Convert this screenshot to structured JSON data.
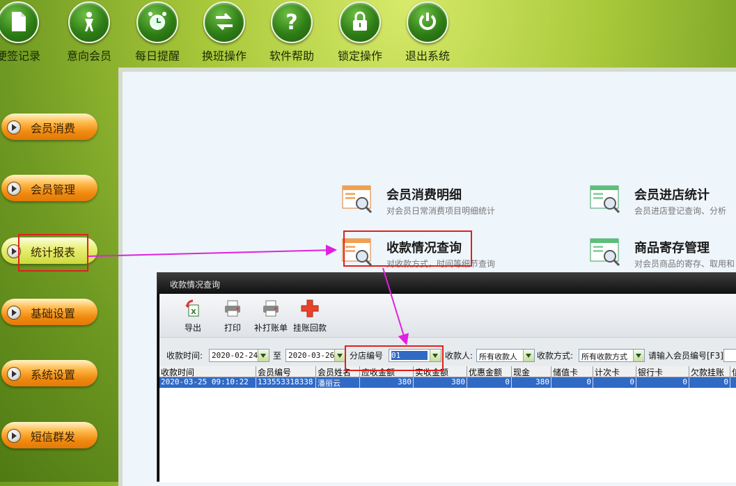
{
  "toolbar": {
    "items": [
      {
        "label": "便签记录",
        "icon": "note-icon"
      },
      {
        "label": "意向会员",
        "icon": "person-icon"
      },
      {
        "label": "每日提醒",
        "icon": "alarm-clock-icon"
      },
      {
        "label": "换班操作",
        "icon": "swap-arrows-icon"
      },
      {
        "label": "软件帮助",
        "icon": "help-icon"
      },
      {
        "label": "锁定操作",
        "icon": "lock-icon"
      },
      {
        "label": "退出系统",
        "icon": "power-icon"
      }
    ]
  },
  "sidebar": {
    "items": [
      {
        "label": "会员消费"
      },
      {
        "label": "会员管理"
      },
      {
        "label": "统计报表"
      },
      {
        "label": "基础设置"
      },
      {
        "label": "系统设置"
      },
      {
        "label": "短信群发"
      }
    ],
    "active": "统计报表"
  },
  "reports": [
    {
      "title": "会员消费明细",
      "desc": "对会员日常消费项目明细统计"
    },
    {
      "title": "会员进店统计",
      "desc": "会员进店登记查询、分析"
    },
    {
      "title": "收款情况查询",
      "desc": "对收款方式，时间等细节查询"
    },
    {
      "title": "商品寄存管理",
      "desc": "对会员商品的寄存、取用和"
    }
  ],
  "dialog": {
    "title": "收款情况查询",
    "tools": [
      {
        "label": "导出",
        "icon": "export-excel-icon"
      },
      {
        "label": "打印",
        "icon": "printer-icon"
      },
      {
        "label": "补打账单",
        "icon": "reprint-icon"
      },
      {
        "label": "挂账回款",
        "icon": "add-plus-icon"
      }
    ],
    "filters": {
      "time_label": "收款时间:",
      "date_from": "2020-02-24",
      "to_label": "至",
      "date_to": "2020-03-26",
      "branch_label": "分店编号",
      "branch_value": "01",
      "payee_label": "收款人:",
      "payee_value": "所有收款人",
      "method_label": "收款方式:",
      "method_value": "所有收款方式",
      "member_label": "请输入会员编号[F3]"
    },
    "columns": [
      "收款时间",
      "会员编号",
      "会员姓名",
      "应收金额",
      "实收金额",
      "优惠金额",
      "现金",
      "储值卡",
      "计次卡",
      "银行卡",
      "欠款挂账",
      "信"
    ],
    "rows": [
      [
        "2020-03-25 09:10:22",
        "133553318338",
        "潘丽云",
        "380",
        "380",
        "0",
        "380",
        "0",
        "0",
        "0",
        "0",
        ""
      ]
    ]
  },
  "colors": {
    "highlight": "#e0201c",
    "arrow": "#e020e0",
    "selection": "#316ac5"
  }
}
